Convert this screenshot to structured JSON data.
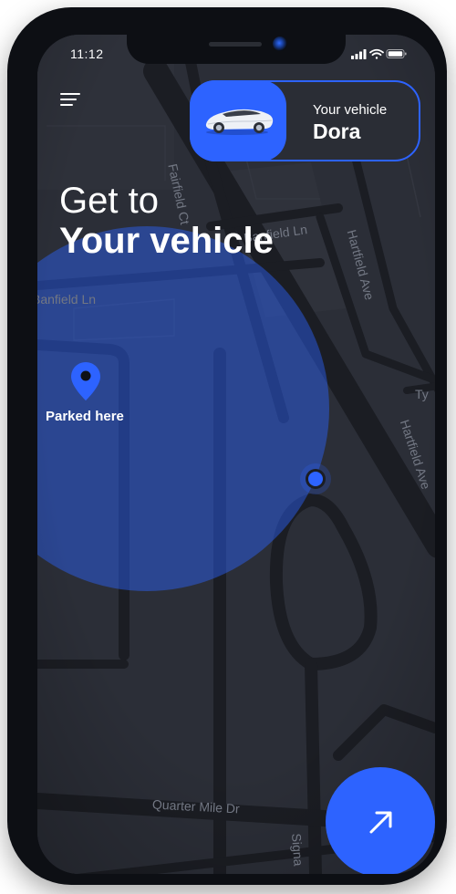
{
  "status_bar": {
    "time": "11:12",
    "icons": [
      "signal-icon",
      "wifi-icon",
      "battery-icon"
    ]
  },
  "header": {
    "menu_icon": "menu-icon",
    "vehicle_card": {
      "caption": "Your vehicle",
      "name": "Dora",
      "icon": "car-icon"
    }
  },
  "headline": {
    "line1": "Get to",
    "line2": "Your vehicle"
  },
  "map": {
    "streets": [
      "Fairfield Ct",
      "Banfield Ln",
      "Banfield Ln",
      "Hartfield Ave",
      "Hartfield Ave",
      "Ty",
      "Quarter Mile Dr",
      "Signa"
    ],
    "parked_label": "Parked here",
    "pin_icon": "location-pin-icon",
    "current_location_icon": "current-location-dot-icon"
  },
  "fab": {
    "icon": "arrow-up-right-icon"
  },
  "colors": {
    "accent": "#2d63ff",
    "map_bg": "#2b2e37",
    "card_bg": "#2a2d35"
  }
}
